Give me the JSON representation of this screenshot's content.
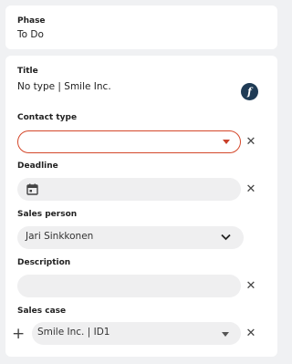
{
  "phase": {
    "label": "Phase",
    "value": "To Do"
  },
  "title": {
    "label": "Title",
    "value": "No type | Smile Inc.",
    "formula_button": "f"
  },
  "contact_type": {
    "label": "Contact type",
    "value": "",
    "clear_icon": "close-icon"
  },
  "deadline": {
    "label": "Deadline",
    "value": "",
    "icon": "calendar-icon",
    "clear_icon": "close-icon"
  },
  "sales_person": {
    "label": "Sales person",
    "value": "Jari Sinkkonen",
    "icon": "chevron-down-icon"
  },
  "description": {
    "label": "Description",
    "value": "",
    "clear_icon": "close-icon"
  },
  "sales_case": {
    "label": "Sales case",
    "value": "Smile Inc. | ID1",
    "add_icon": "plus-icon",
    "clear_icon": "close-icon"
  },
  "colors": {
    "error_border": "#d4472a",
    "field_bg": "#efeff0",
    "formula_button_bg": "#1f3b55",
    "page_bg": "#f0f1f3"
  }
}
